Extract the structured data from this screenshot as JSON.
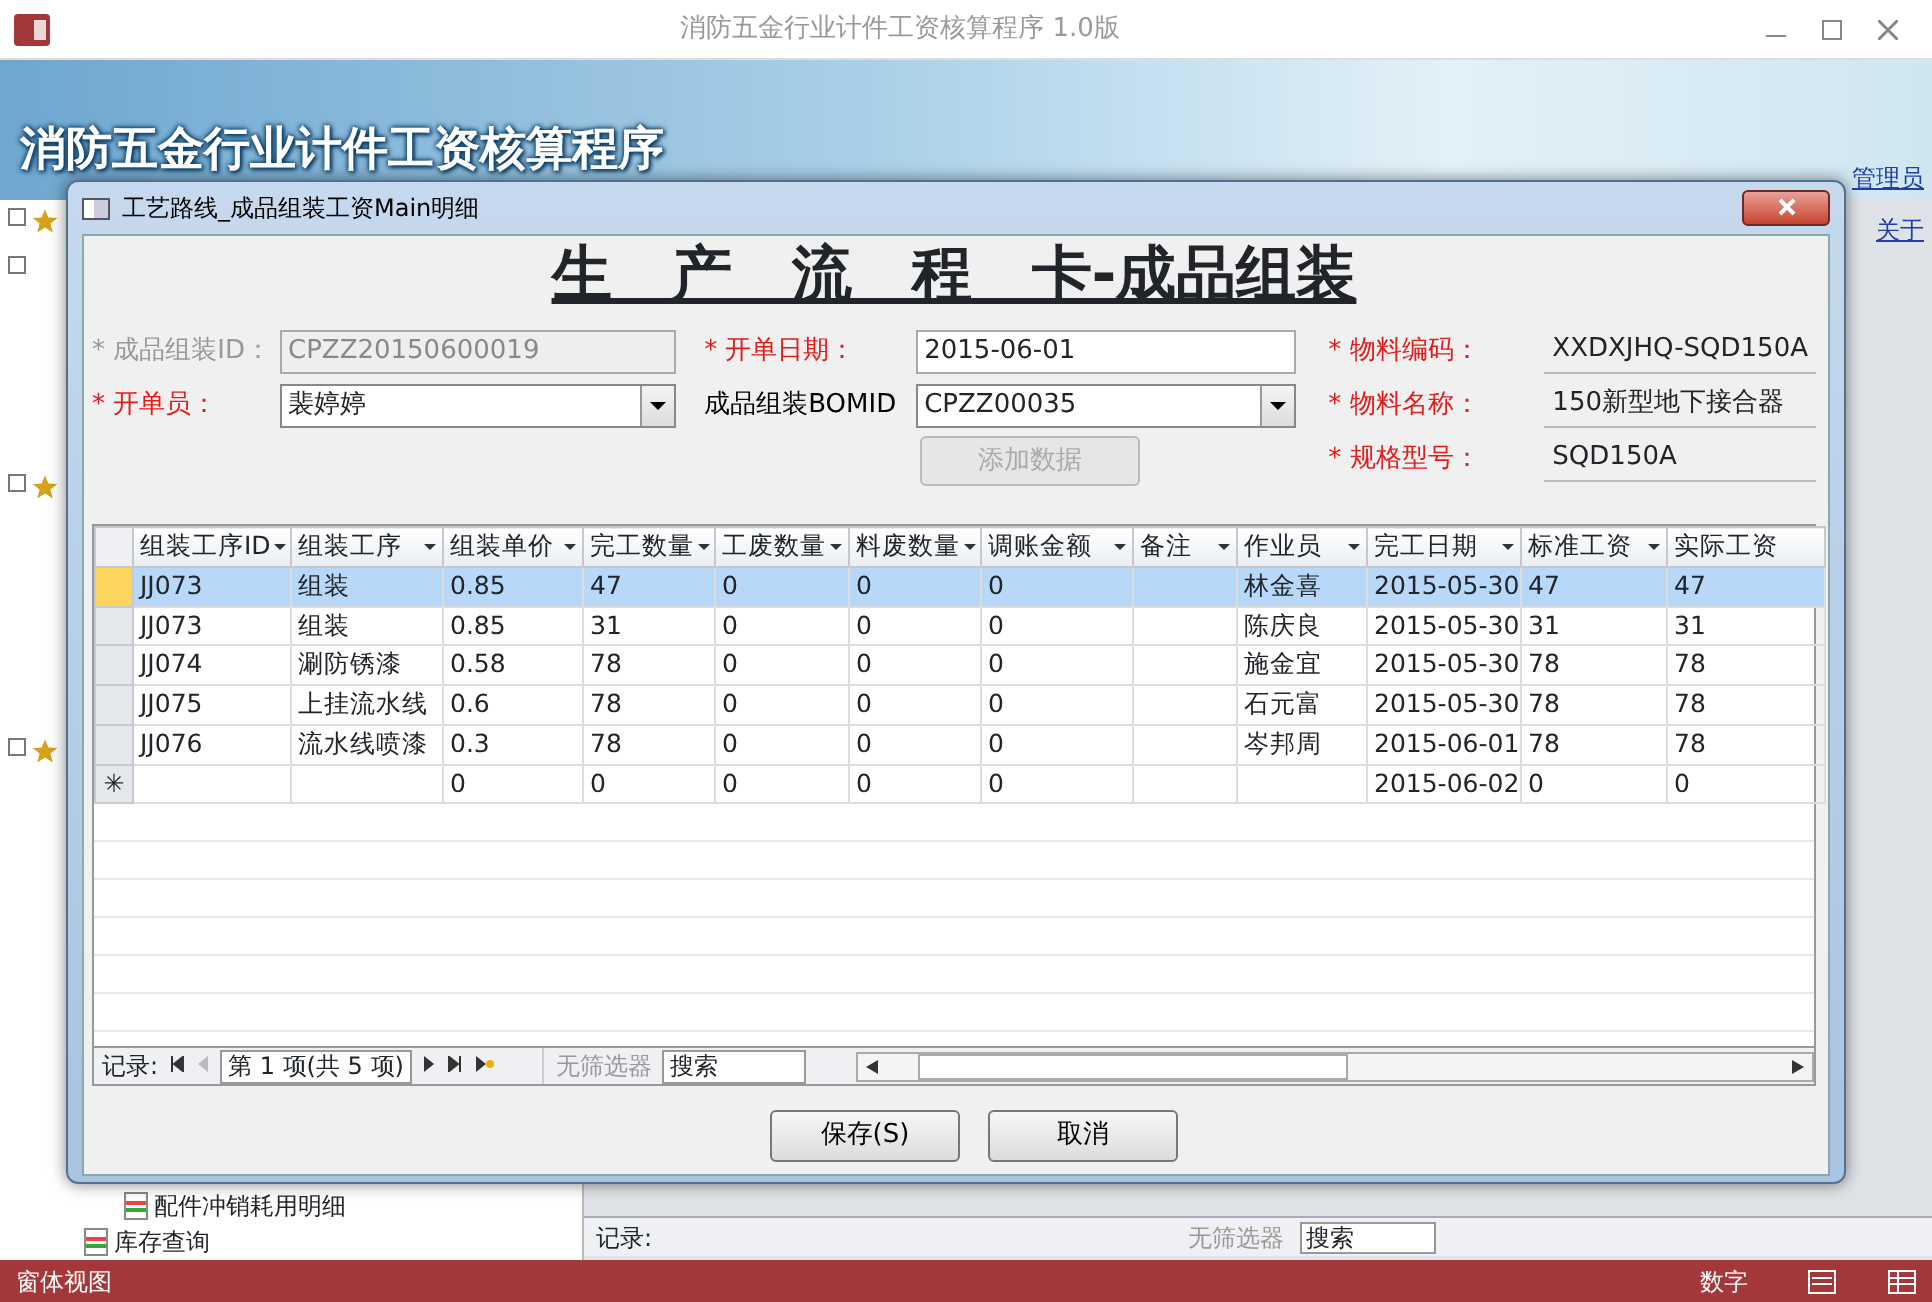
{
  "app": {
    "title": "消防五金行业计件工资核算程序 1.0版",
    "banner_title": "消防五金行业计件工资核算程序",
    "user_link": "管理员",
    "about_link": "关于"
  },
  "nav_pane": {
    "items": [
      {
        "label": "配件冲销耗用明细"
      },
      {
        "label": "库存查询"
      }
    ]
  },
  "background_nav": {
    "record_label": "记录:",
    "filter": "无筛选器",
    "search": "搜索"
  },
  "dialog": {
    "title": "工艺路线_成品组装工资Main明细",
    "heading": "生　产　流　程　卡-成品组装",
    "field_columns": [
      [
        {
          "label": "* 成品组装ID：",
          "kind": "text",
          "required": true,
          "disabled": true,
          "value": "CPZZ20150600019"
        },
        {
          "label": "* 开单员：",
          "kind": "combo",
          "required": true,
          "disabled": false,
          "value": "裴婷婷"
        }
      ],
      [
        {
          "label": "* 开单日期：",
          "kind": "text",
          "required": true,
          "disabled": false,
          "value": "2015-06-01"
        },
        {
          "label": "成品组装BOMID",
          "kind": "combo",
          "required": false,
          "disabled": false,
          "value": "CPZZ00035"
        }
      ],
      [
        {
          "label": "* 物料编码：",
          "kind": "display",
          "required": true,
          "value": "XXDXJHQ-SQD150A"
        },
        {
          "label": "* 物料名称：",
          "kind": "display",
          "required": true,
          "value": "150新型地下接合器"
        },
        {
          "label": "* 规格型号：",
          "kind": "display",
          "required": true,
          "value": "SQD150A"
        }
      ]
    ],
    "add_button": {
      "label": "添加数据",
      "disabled": true
    },
    "grid": {
      "columns": [
        {
          "label": "组装工序ID",
          "sortable": true
        },
        {
          "label": "组装工序",
          "sortable": true
        },
        {
          "label": "组装单价",
          "sortable": true
        },
        {
          "label": "完工数量",
          "sortable": true
        },
        {
          "label": "工废数量",
          "sortable": true
        },
        {
          "label": "料废数量",
          "sortable": true
        },
        {
          "label": "调账金额",
          "sortable": true
        },
        {
          "label": "备注",
          "sortable": true
        },
        {
          "label": "作业员",
          "sortable": true
        },
        {
          "label": "完工日期",
          "sortable": true
        },
        {
          "label": "标准工资",
          "sortable": true
        },
        {
          "label": "实际工资",
          "sortable": false
        }
      ],
      "rows": [
        {
          "selected": true,
          "cells": [
            "JJ073",
            "组装",
            "0.85",
            "47",
            "0",
            "0",
            "0",
            "",
            "林金喜",
            "2015-05-30",
            "47",
            "47"
          ]
        },
        {
          "selected": false,
          "cells": [
            "JJ073",
            "组装",
            "0.85",
            "31",
            "0",
            "0",
            "0",
            "",
            "陈庆良",
            "2015-05-30",
            "31",
            "31"
          ]
        },
        {
          "selected": false,
          "cells": [
            "JJ074",
            "涮防锈漆",
            "0.58",
            "78",
            "0",
            "0",
            "0",
            "",
            "施金宜",
            "2015-05-30",
            "78",
            "78"
          ]
        },
        {
          "selected": false,
          "cells": [
            "JJ075",
            "上挂流水线",
            "0.6",
            "78",
            "0",
            "0",
            "0",
            "",
            "石元富",
            "2015-05-30",
            "78",
            "78"
          ]
        },
        {
          "selected": false,
          "cells": [
            "JJ076",
            "流水线喷漆",
            "0.3",
            "78",
            "0",
            "0",
            "0",
            "",
            "岑邦周",
            "2015-06-01",
            "78",
            "78"
          ]
        }
      ],
      "new_row": {
        "marker": "✳",
        "cells": [
          "",
          "",
          "0",
          "0",
          "0",
          "0",
          "0",
          "",
          "",
          "2015-06-02",
          "0",
          "0"
        ]
      }
    },
    "record_nav": {
      "record_label": "记录:",
      "position": "第 1 项(共 5 项)",
      "filter": "无筛选器",
      "search": "搜索"
    },
    "buttons": [
      "保存(S)",
      "取消"
    ]
  },
  "status_bar": {
    "view": "窗体视图",
    "mode": "数字"
  }
}
